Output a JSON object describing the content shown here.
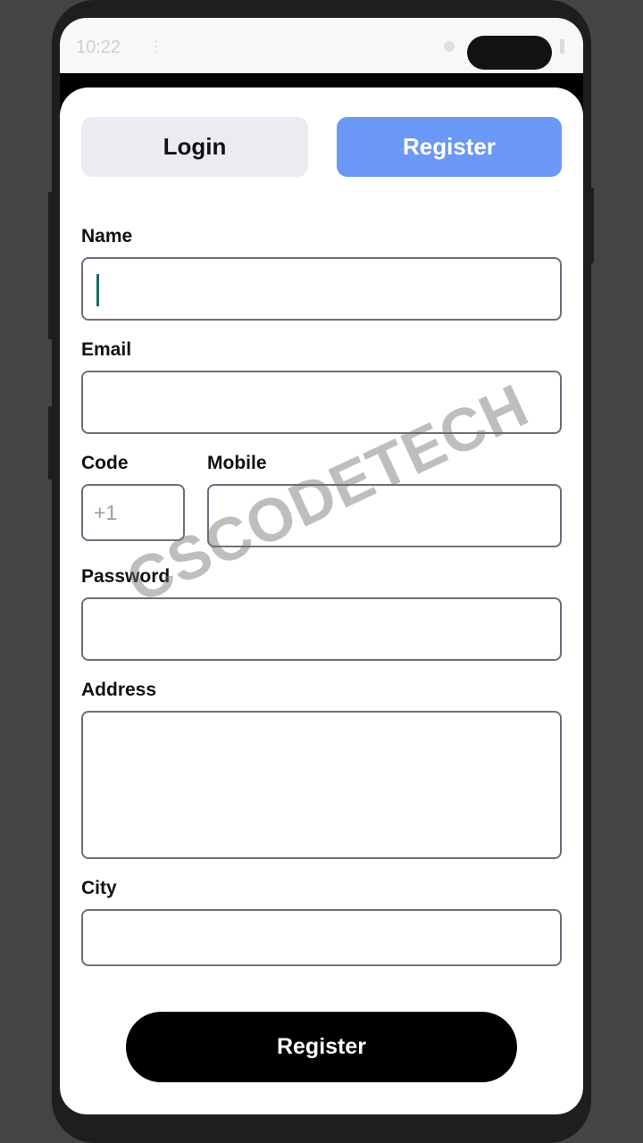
{
  "status_bar": {
    "time": "10:22",
    "signal_icon": "signal-icon"
  },
  "tabs": {
    "login_label": "Login",
    "register_label": "Register"
  },
  "form": {
    "name_label": "Name",
    "name_value": "",
    "email_label": "Email",
    "email_value": "",
    "code_label": "Code",
    "code_value": "+1",
    "mobile_label": "Mobile",
    "mobile_value": "",
    "password_label": "Password",
    "password_value": "",
    "address_label": "Address",
    "address_value": "",
    "city_label": "City",
    "city_value": ""
  },
  "submit_label": "Register",
  "watermark": "CSCODETECH",
  "colors": {
    "background": "#444444",
    "phone_frame": "#1e1e1e",
    "active_tab": "#6b98f7",
    "inactive_tab": "#ebebf2",
    "field_border": "#6e6e7e",
    "submit_button": "#000000",
    "caret": "#1a6b5f"
  }
}
